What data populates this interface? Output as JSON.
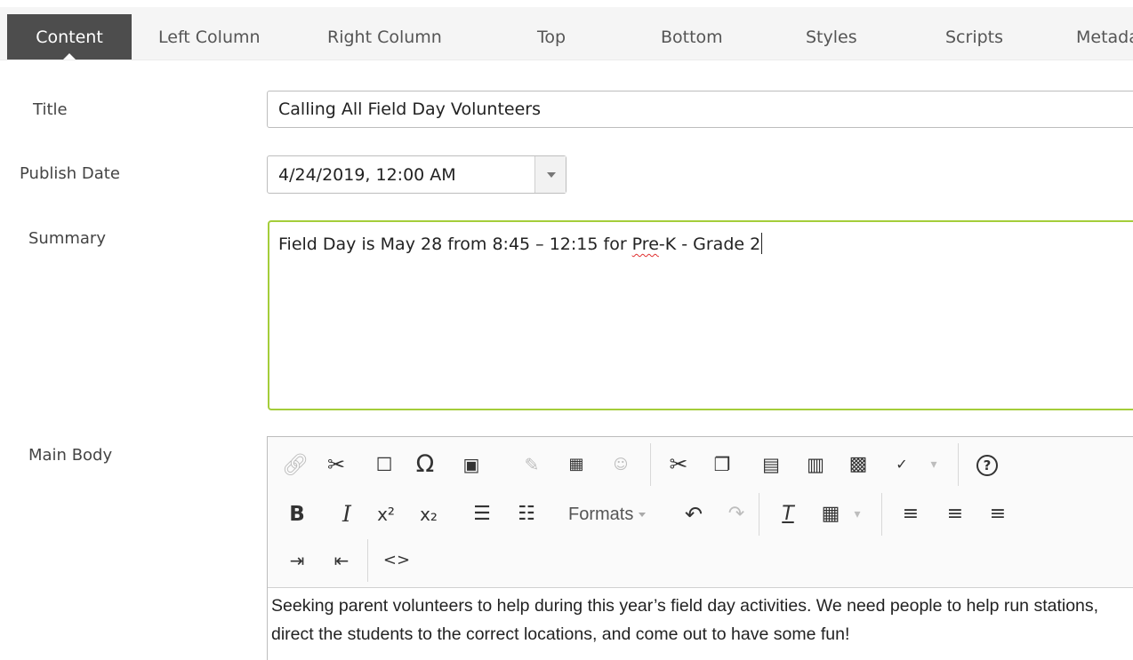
{
  "tabs": [
    {
      "label": "Content",
      "active": true
    },
    {
      "label": "Left Column"
    },
    {
      "label": "Right Column"
    },
    {
      "label": "Top"
    },
    {
      "label": "Bottom"
    },
    {
      "label": "Styles"
    },
    {
      "label": "Scripts"
    },
    {
      "label": "Metadata"
    }
  ],
  "form": {
    "title_label": "Title",
    "title_value": "Calling All Field Day Volunteers",
    "publish_label": "Publish Date",
    "publish_value": "4/24/2019, 12:00 AM",
    "summary_label": "Summary",
    "summary_before": "Field Day is May 28 from 8:45 – 12:15 for ",
    "summary_misspelled": "Pre",
    "summary_after": "-K - Grade 2",
    "main_body_label": "Main Body",
    "main_body_text": "Seeking parent volunteers to help during this year’s field day activities. We need people to help run stations, direct the students to the correct locations, and come out to have some fun!"
  },
  "toolbar": {
    "formats_label": "Formats",
    "icons_row1": [
      "link-icon",
      "unlink-icon",
      "anchor-icon",
      "special-character-icon",
      "image-icon",
      "edit-image-icon",
      "media-icon",
      "user-icon",
      "cut-icon",
      "copy-icon",
      "paste-icon",
      "paste-text-icon",
      "find-icon",
      "spellcheck-icon",
      "help-icon"
    ],
    "icons_row2": [
      "bold-icon",
      "italic-icon",
      "superscript-icon",
      "subscript-icon",
      "bullet-list-icon",
      "numbered-list-icon",
      "undo-icon",
      "redo-icon",
      "clear-formatting-icon",
      "table-icon",
      "align-left-icon",
      "align-center-icon",
      "align-right-icon"
    ],
    "icons_row3": [
      "indent-icon",
      "outdent-icon",
      "source-code-icon"
    ]
  },
  "colors": {
    "active_tab": "#4d4d4d",
    "focus_border": "#a4cd3a",
    "spell_underline": "#e03030"
  }
}
